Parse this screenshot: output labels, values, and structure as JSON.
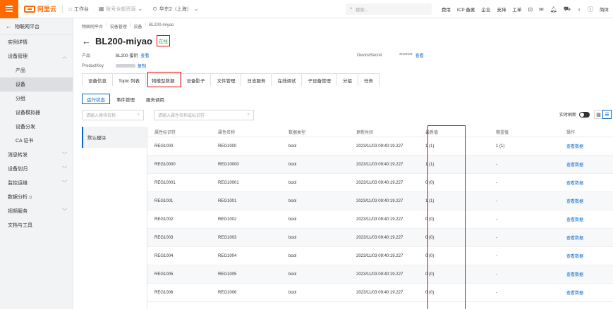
{
  "topbar": {
    "logo": "阿里云",
    "workbench": "工作台",
    "resource_group": "账号全部资源",
    "region": "华东2（上海）",
    "search_placeholder": "搜索...",
    "links": [
      "费用",
      "ICP 备案",
      "企业",
      "支持",
      "工单"
    ],
    "lang": "简体"
  },
  "sidebar": {
    "back": "物联网平台",
    "items": [
      {
        "label": "实例详情",
        "sub": false,
        "chevron": "",
        "ext": ""
      },
      {
        "label": "设备管理",
        "sub": false,
        "chevron": "︿",
        "ext": ""
      },
      {
        "label": "产品",
        "sub": true,
        "chevron": "",
        "ext": ""
      },
      {
        "label": "设备",
        "sub": true,
        "chevron": "",
        "ext": "",
        "active": true
      },
      {
        "label": "分组",
        "sub": true,
        "chevron": "",
        "ext": ""
      },
      {
        "label": "设备模拟器",
        "sub": true,
        "chevron": "",
        "ext": ""
      },
      {
        "label": "设备分发",
        "sub": true,
        "chevron": "",
        "ext": ""
      },
      {
        "label": "CA 证书",
        "sub": true,
        "chevron": "",
        "ext": ""
      },
      {
        "label": "消息转发",
        "sub": false,
        "chevron": "﹀",
        "ext": ""
      },
      {
        "label": "设备划归",
        "sub": false,
        "chevron": "﹀",
        "ext": ""
      },
      {
        "label": "监控运维",
        "sub": false,
        "chevron": "﹀",
        "ext": ""
      },
      {
        "label": "数据分析",
        "sub": false,
        "chevron": "",
        "ext": "⧉"
      },
      {
        "label": "视频服务",
        "sub": false,
        "chevron": "﹀",
        "ext": ""
      },
      {
        "label": "文档与工具",
        "sub": false,
        "chevron": "",
        "ext": ""
      }
    ]
  },
  "breadcrumb": [
    "物联网平台",
    "设备管理",
    "设备",
    "BL200-miyao"
  ],
  "device": {
    "name": "BL200-miyao",
    "status": "在线",
    "product_label": "产品",
    "product_value": "BL200-蜜钥",
    "product_link": "查看",
    "productkey_label": "ProductKey",
    "productkey_link": "复制",
    "secret_label": "DeviceSecret",
    "secret_value": "********",
    "secret_link": "查看"
  },
  "tabs": [
    "设备信息",
    "Topic 列表",
    "物模型数据",
    "设备影子",
    "文件管理",
    "日志服务",
    "在线调试",
    "子设备管理",
    "分组",
    "任务"
  ],
  "subtabs": [
    "运行状态",
    "事件管理",
    "服务调用"
  ],
  "module_search_placeholder": "请输入模块名称",
  "prop_search_placeholder": "请输入属性名称或标识符",
  "realtime_refresh": "实时刷新",
  "modules": [
    "默认模块"
  ],
  "table": {
    "headers": [
      "属性标识符",
      "属性名称",
      "数据类型",
      "更新时间",
      "最新值",
      "期望值",
      "操作"
    ],
    "rows": [
      [
        "REG1000",
        "REG1000",
        "bool",
        "2023/11/03 09:40:19.227",
        "1 (1)",
        "1 (1)",
        "查看数据"
      ],
      [
        "REG10000",
        "REG10000",
        "bool",
        "2023/11/03 09:40:19.227",
        "1 (1)",
        "-",
        "查看数据"
      ],
      [
        "REG10001",
        "REG10001",
        "bool",
        "2023/11/03 09:40:19.227",
        "0 (0)",
        "-",
        "查看数据"
      ],
      [
        "REG1001",
        "REG1001",
        "bool",
        "2023/11/03 09:40:19.227",
        "1 (1)",
        "-",
        "查看数据"
      ],
      [
        "REG1002",
        "REG1002",
        "bool",
        "2023/11/03 09:40:19.227",
        "0 (0)",
        "-",
        "查看数据"
      ],
      [
        "REG1003",
        "REG1003",
        "bool",
        "2023/11/03 09:40:19.227",
        "0 (0)",
        "-",
        "查看数据"
      ],
      [
        "REG1004",
        "REG1004",
        "bool",
        "2023/11/03 09:40:19.227",
        "0 (0)",
        "-",
        "查看数据"
      ],
      [
        "REG1005",
        "REG1005",
        "bool",
        "2023/11/03 09:40:19.227",
        "0 (0)",
        "-",
        "查看数据"
      ],
      [
        "REG1006",
        "REG1006",
        "bool",
        "2023/11/03 09:40:19.227",
        "0 (0)",
        "-",
        "查看数据"
      ]
    ]
  },
  "colors": {
    "brand": "#ff6a00",
    "link": "#0064c8",
    "online": "#2aa34a",
    "annotation": "#ee0000"
  }
}
